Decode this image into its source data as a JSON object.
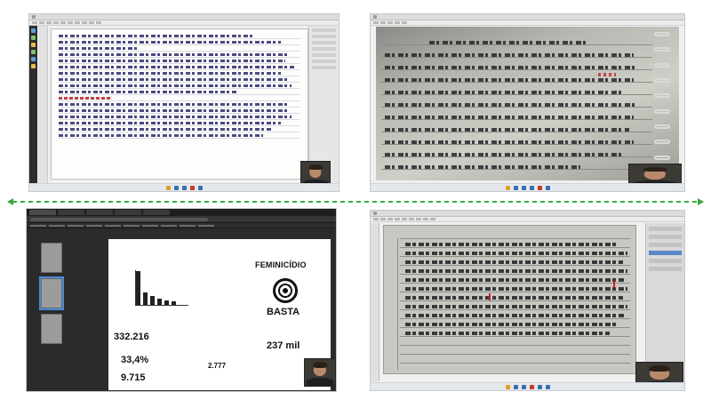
{
  "bottom_left": {
    "infographic": {
      "brand_line1": "FEMINICÍDIO",
      "brand_line2": "BASTA",
      "stat_total": "332.216",
      "stat_percent": "33,4%",
      "stat_count": "9.715",
      "stat_mid": "2.777",
      "stat_big": "237 mil"
    }
  },
  "colors": {
    "divider_arrow": "#3aa83a",
    "annotation_mark": "#d02020"
  },
  "icons": [
    "windows-start-icon",
    "app-icon",
    "webcam-feed",
    "double-arrow-icon"
  ]
}
